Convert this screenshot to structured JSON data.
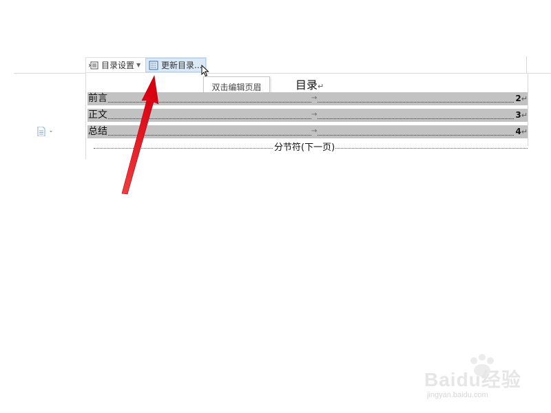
{
  "toolbar": {
    "settings_label": "目录设置",
    "update_label": "更新目录..."
  },
  "tooltip": {
    "text": "双击编辑页眉"
  },
  "toc": {
    "title": "目录",
    "paragraph_mark": "↵",
    "tab_mark": "→",
    "entries": [
      {
        "label": "前言",
        "page": "2"
      },
      {
        "label": "正文",
        "page": "3"
      },
      {
        "label": "总结",
        "page": "4"
      }
    ]
  },
  "section_break": {
    "label": "分节符(下一页)"
  },
  "icons": {
    "settings": "toc-settings-icon",
    "update": "toc-update-icon",
    "document": "document-icon",
    "cursor": "mouse-cursor-icon",
    "annotation": "red-arrow-annotation"
  },
  "colors": {
    "field_shading": "#c2c2c2",
    "button_highlight": "#dbe8f6",
    "annotation_arrow": "#e8101a"
  },
  "watermark": {
    "brand": "Baidu经验",
    "url": "jingyan.baidu.com"
  }
}
